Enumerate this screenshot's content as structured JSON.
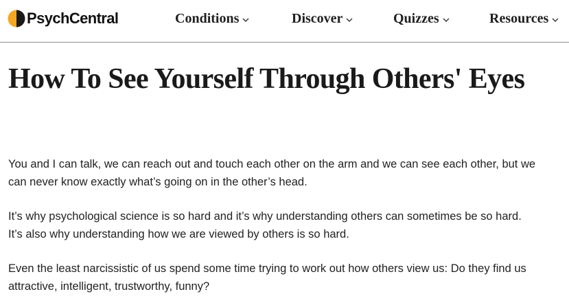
{
  "header": {
    "logo_text": "PsychCentral",
    "nav": [
      {
        "label": "Conditions",
        "icon": "chevron-down-icon"
      },
      {
        "label": "Discover",
        "icon": "chevron-down-icon"
      },
      {
        "label": "Quizzes",
        "icon": "chevron-down-icon"
      },
      {
        "label": "Resources",
        "icon": "chevron-down-icon"
      }
    ]
  },
  "article": {
    "title": "How To See Yourself Through Others' Eyes",
    "paragraphs": [
      "You and I can talk, we can reach out and touch each other on the arm and we can see each other, but we can never know exactly what’s going on in the other’s head.",
      "It’s why psychological science is so hard and it’s why understanding others can sometimes be so hard. It’s also why understanding how we are viewed by others is so hard.",
      "Even the least narcissistic of us spend some time trying to work out how others view us: Do they find us attractive, intelligent, trustworthy, funny?"
    ]
  },
  "colors": {
    "logo_orange": "#f5a623",
    "logo_dark": "#1a1a1a",
    "divider": "#8f8f8f",
    "text": "#222222"
  }
}
